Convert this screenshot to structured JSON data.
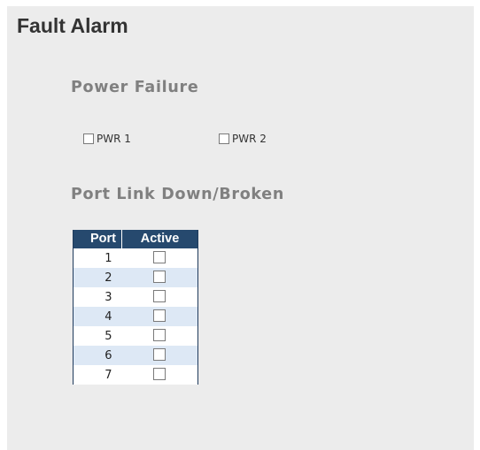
{
  "page": {
    "title": "Fault Alarm"
  },
  "power_failure": {
    "title": "Power Failure",
    "items": [
      {
        "label": "PWR 1",
        "checked": false
      },
      {
        "label": "PWR 2",
        "checked": false
      }
    ]
  },
  "port_link": {
    "title": "Port Link Down/Broken",
    "columns": [
      "Port",
      "Active"
    ],
    "rows": [
      {
        "port": "1",
        "active": false
      },
      {
        "port": "2",
        "active": false
      },
      {
        "port": "3",
        "active": false
      },
      {
        "port": "4",
        "active": false
      },
      {
        "port": "5",
        "active": false
      },
      {
        "port": "6",
        "active": false
      },
      {
        "port": "7",
        "active": false
      }
    ]
  },
  "colors": {
    "header_bg": "#26496e",
    "row_alt_bg": "#dde8f5",
    "panel_bg": "#ececec",
    "section_title": "#808080"
  }
}
